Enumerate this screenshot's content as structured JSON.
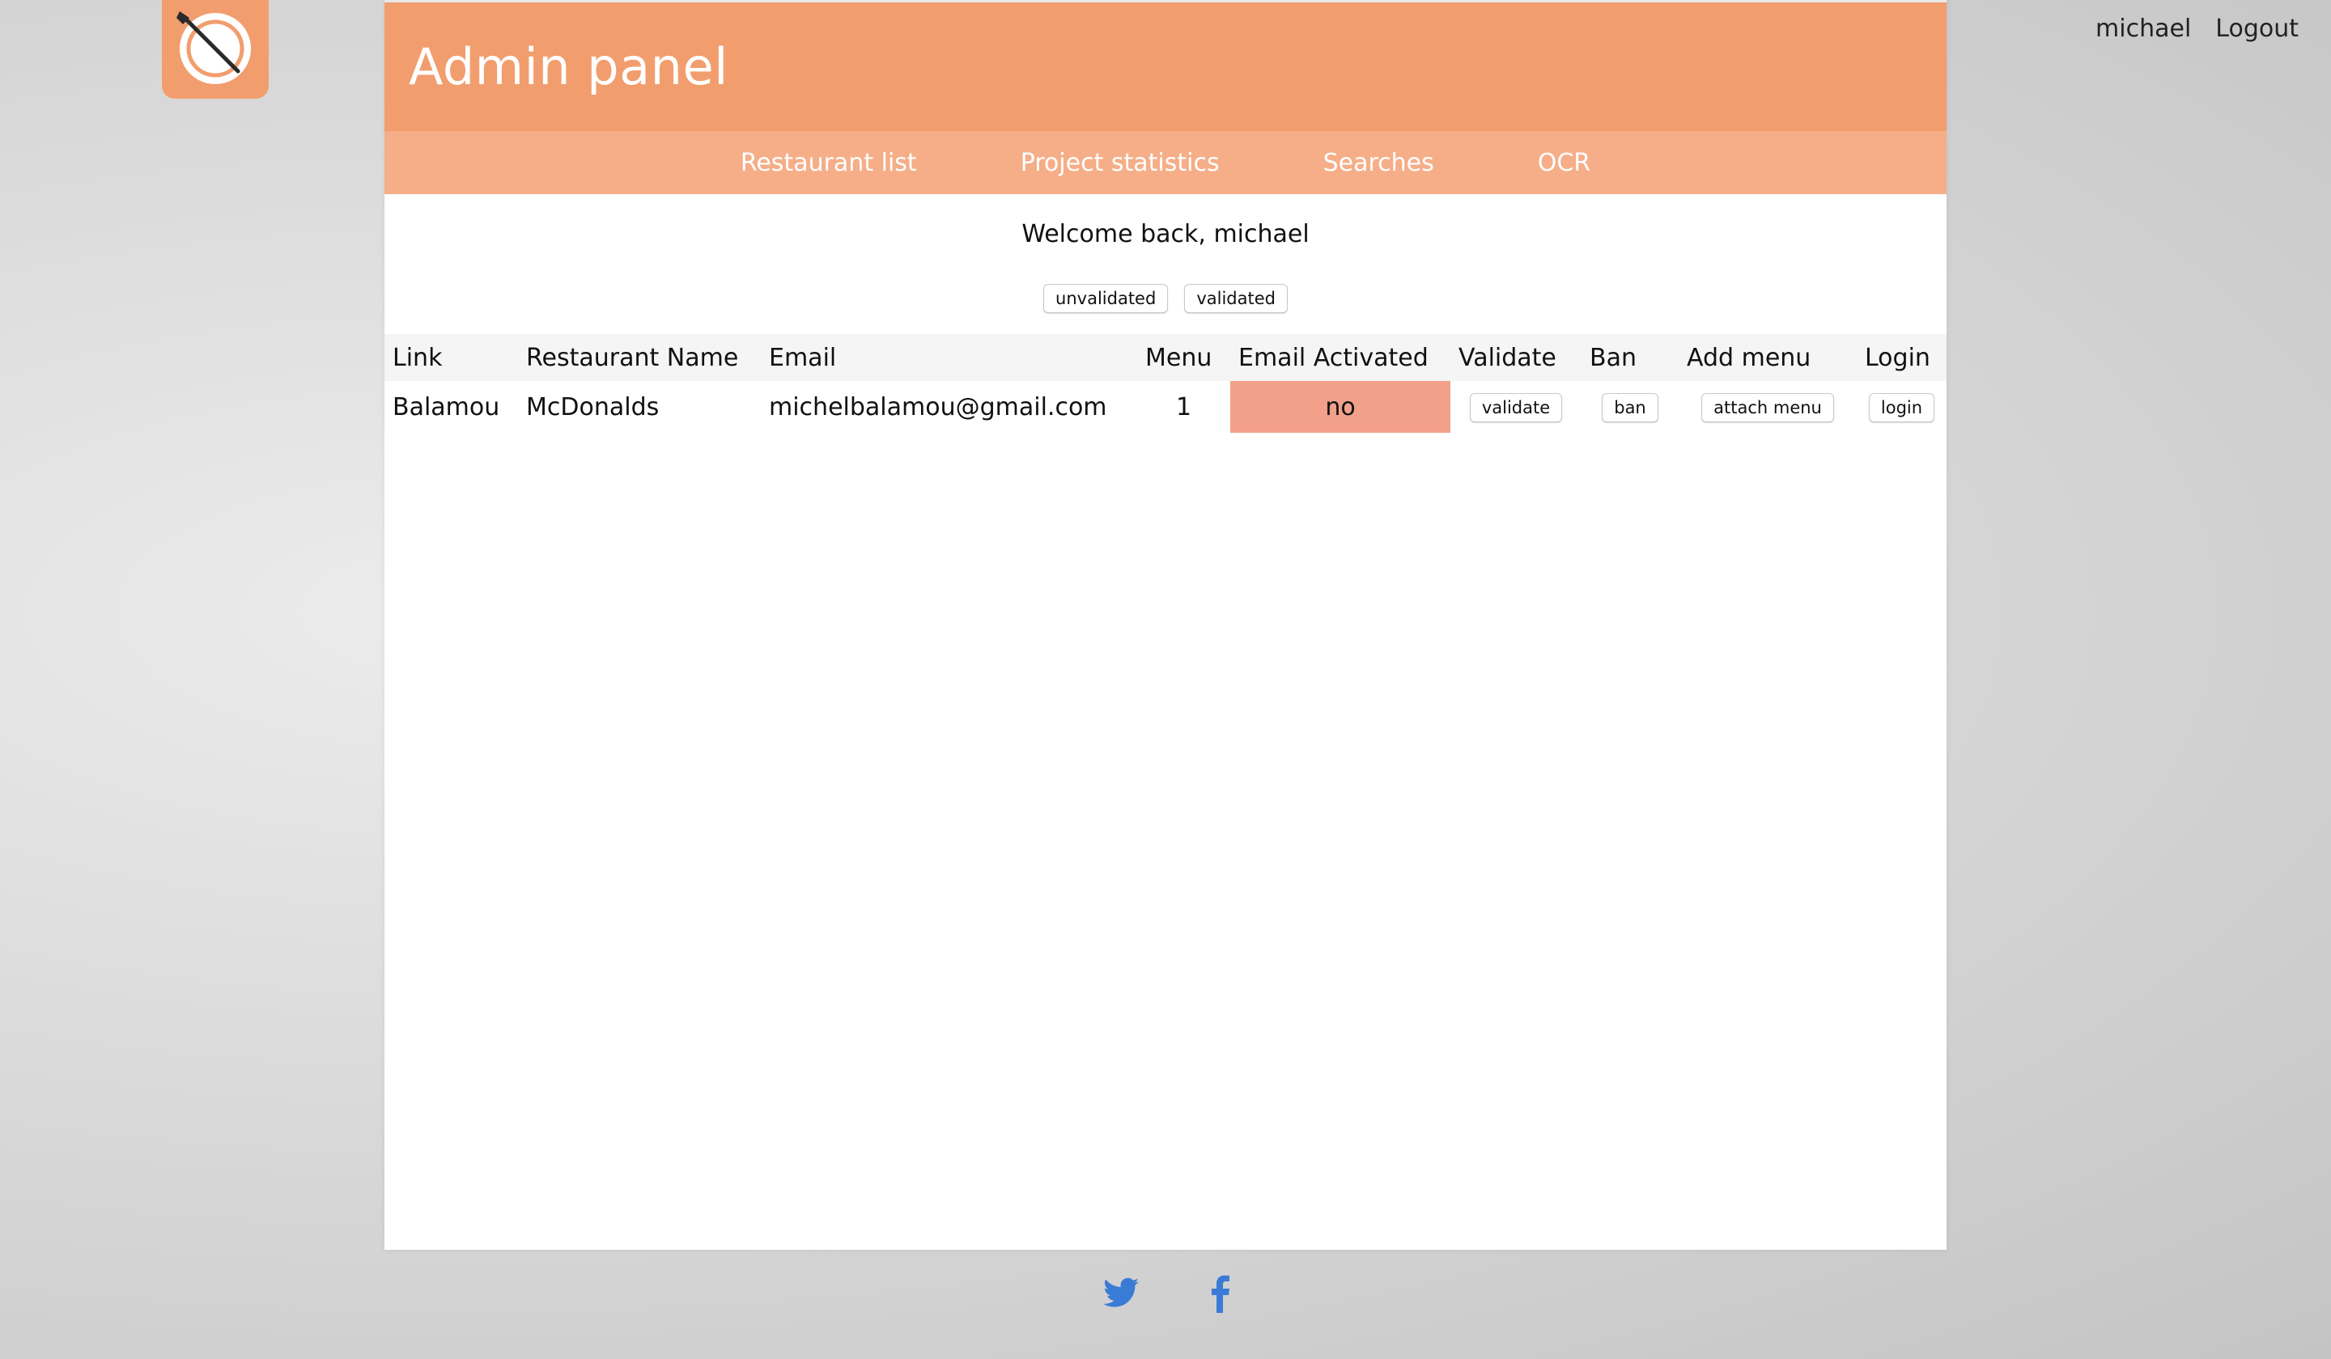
{
  "header": {
    "title": "Admin panel",
    "user_name": "michael",
    "logout_label": "Logout"
  },
  "nav": {
    "items": [
      "Restaurant list",
      "Project statistics",
      "Searches",
      "OCR"
    ]
  },
  "welcome_text": "Welcome back, michael",
  "filters": {
    "unvalidated_label": "unvalidated",
    "validated_label": "validated"
  },
  "table": {
    "columns": [
      "Link",
      "Restaurant Name",
      "Email",
      "Menu",
      "Email Activated",
      "Validate",
      "Ban",
      "Add menu",
      "Login"
    ],
    "rows": [
      {
        "link": "Balamou",
        "restaurant_name": "McDonalds",
        "email": "michelbalamou@gmail.com",
        "menu": "1",
        "email_activated": "no",
        "validate_label": "validate",
        "ban_label": "ban",
        "add_menu_label": "attach menu",
        "login_label": "login"
      }
    ]
  },
  "colors": {
    "brand": "#f29d6e",
    "nav": "#f5ae88",
    "status_no": "#f2a08a",
    "link": "#3a7bd5"
  },
  "footer": {
    "icons": [
      "twitter-icon",
      "facebook-icon"
    ]
  }
}
